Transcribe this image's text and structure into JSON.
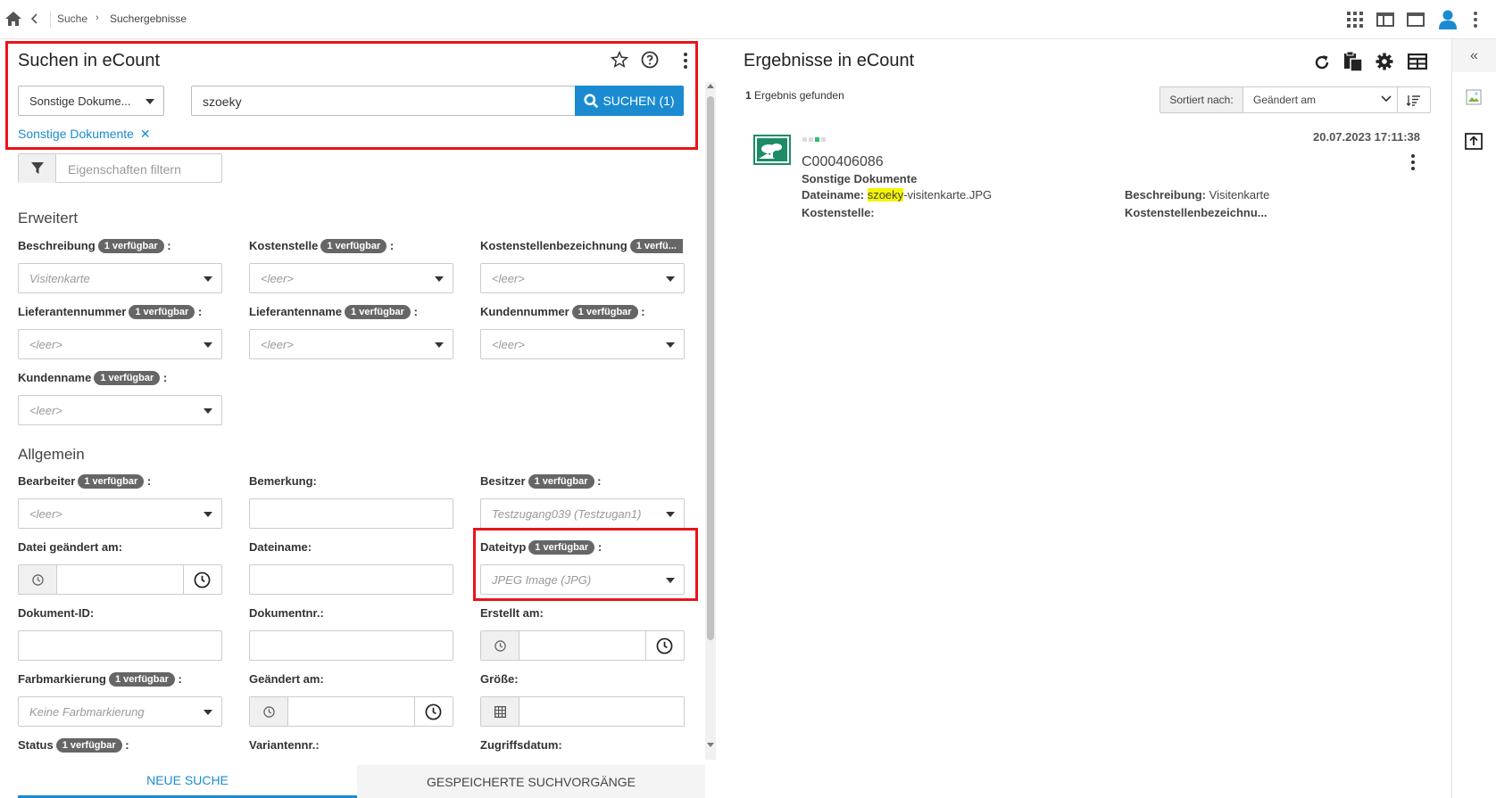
{
  "breadcrumb": {
    "items": [
      "Suche",
      "Suchergebnisse"
    ]
  },
  "left": {
    "title": "Suchen in  eCount",
    "doc_type_select": "Sonstige Dokume...",
    "search_value": "szoeky",
    "search_button": "SUCHEN (1)",
    "active_filter": "Sonstige Dokumente",
    "filter_placeholder": "Eigenschaften filtern",
    "section_erweitert": "Erweitert",
    "section_allgemein": "Allgemein",
    "badge": "1 verfügbar",
    "badge_truncated": "1 verfü...",
    "colon": ":",
    "fields": {
      "beschreibung": {
        "label": "Beschreibung",
        "value": "Visitenkarte"
      },
      "kostenstelle": {
        "label": "Kostenstelle",
        "value": "<leer>"
      },
      "kostenstellenbezeichnung": {
        "label": "Kostenstellenbezeichnung",
        "value": "<leer>"
      },
      "lieferantennummer": {
        "label": "Lieferantennummer",
        "value": "<leer>"
      },
      "lieferantenname": {
        "label": "Lieferantenname",
        "value": "<leer>"
      },
      "kundennummer": {
        "label": "Kundennummer",
        "value": "<leer>"
      },
      "kundenname": {
        "label": "Kundenname",
        "value": "<leer>"
      },
      "bearbeiter": {
        "label": "Bearbeiter",
        "value": "<leer>"
      },
      "bemerkung": {
        "label": "Bemerkung:"
      },
      "besitzer": {
        "label": "Besitzer",
        "value": "Testzugang039 (Testzugan1)"
      },
      "datei_geaendert": {
        "label": "Datei geändert am:"
      },
      "dateiname": {
        "label": "Dateiname:"
      },
      "dateityp": {
        "label": "Dateityp",
        "value": "JPEG Image (JPG)"
      },
      "dokument_id": {
        "label": "Dokument-ID:"
      },
      "dokumentnr": {
        "label": "Dokumentnr.:"
      },
      "erstellt_am": {
        "label": "Erstellt am:"
      },
      "farbmarkierung": {
        "label": "Farbmarkierung",
        "value": "Keine Farbmarkierung"
      },
      "geaendert_am": {
        "label": "Geändert am:"
      },
      "groesse": {
        "label": "Größe:"
      },
      "status": {
        "label": "Status"
      },
      "variantennr": {
        "label": "Variantennr.:"
      },
      "zugriffsdatum": {
        "label": "Zugriffsdatum:"
      }
    },
    "tabs": [
      "NEUE SUCHE",
      "GESPEICHERTE SUCHVORGÄNGE"
    ]
  },
  "right": {
    "title": "Ergebnisse in eCount",
    "result_count": "1",
    "result_text": " Ergebnis gefunden",
    "sort_label": "Sortiert nach:",
    "sort_value": "Geändert am",
    "result": {
      "date": "20.07.2023 17:11:38",
      "id": "C000406086",
      "category": "Sonstige Dokumente",
      "dateiname_label": "Dateiname:",
      "dateiname_highlight": "szoeky",
      "dateiname_rest": "-visitenkarte.JPG",
      "kostenstelle_label": "Kostenstelle:",
      "beschreibung_label": "Beschreibung:",
      "beschreibung_value": "Visitenkarte",
      "kostenstellenbez_label": "Kostenstellenbezeichnu..."
    }
  },
  "colors": {
    "accent": "#1a8bd0",
    "red_highlight": "#e8141b",
    "badge": "#666666",
    "search_highlight": "#f5f500"
  }
}
